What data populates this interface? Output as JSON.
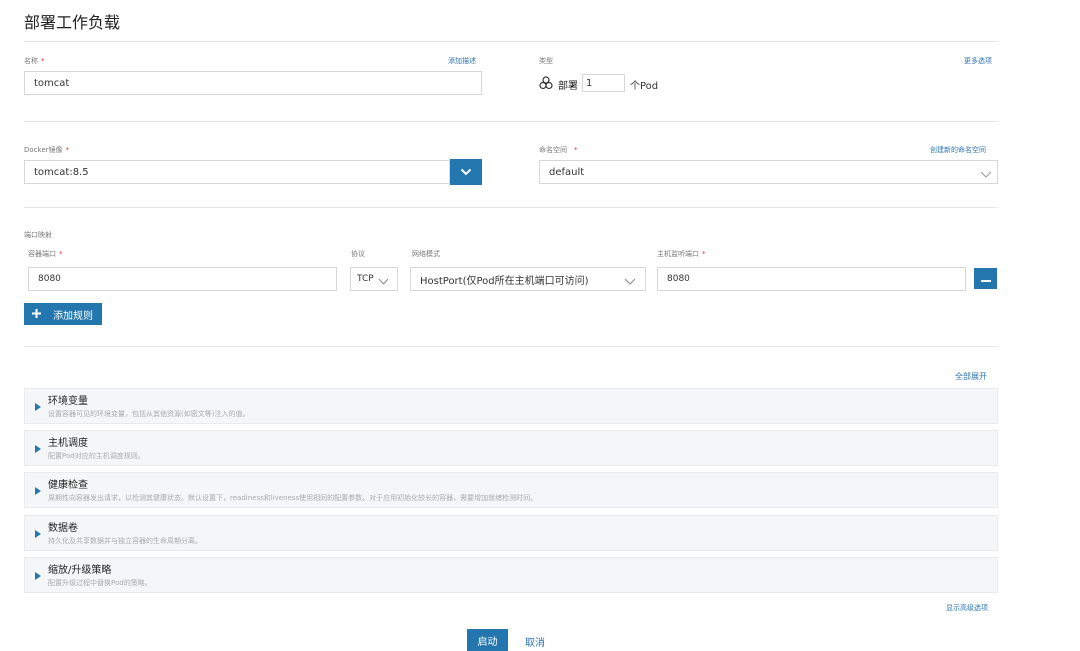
{
  "page": {
    "title": "部署工作负载"
  },
  "name": {
    "label": "名称",
    "value": "tomcat",
    "add_description": "添加描述"
  },
  "type": {
    "label": "类型",
    "more_options": "更多选项",
    "deploy_label": "部署",
    "count": "1",
    "unit": "个Pod"
  },
  "image": {
    "label": "Docker镜像",
    "value": "tomcat:8.5"
  },
  "namespace": {
    "label": "命名空间",
    "create_link": "创建新的命名空间",
    "value": "default"
  },
  "ports": {
    "section_label": "端口映射",
    "container_port_label": "容器端口",
    "protocol_label": "协议",
    "network_mode_label": "网络模式",
    "host_port_label": "主机监听端口",
    "rows": [
      {
        "container_port": "8080",
        "protocol": "TCP",
        "network_mode": "HostPort(仅Pod所在主机端口可访问)",
        "host_port": "8080"
      }
    ],
    "add_rule": "添加规则"
  },
  "expand_all": "全部展开",
  "sections": [
    {
      "title": "环境变量",
      "desc": "设置容器可见的环境变量，包括从其他资源(如密文等)注入的值。"
    },
    {
      "title": "主机调度",
      "desc": "配置Pod对应的主机调度规则。"
    },
    {
      "title": "健康检查",
      "desc": "周期性向容器发出请求，以检测其健康状态。默认设置下，readiness和liveness使用相同的配置参数。对于应用初始化较长的容器，需要增加就绪检测时间。"
    },
    {
      "title": "数据卷",
      "desc": "持久化及共享数据并与独立容器的生命周期分离。"
    },
    {
      "title": "缩放/升级策略",
      "desc": "配置升级过程中替换Pod的策略。"
    }
  ],
  "show_advanced": "显示高级选项",
  "actions": {
    "launch": "启动",
    "cancel": "取消"
  },
  "colors": {
    "accent": "#2477ae",
    "link": "#2a74b5",
    "required": "#e0353a"
  }
}
